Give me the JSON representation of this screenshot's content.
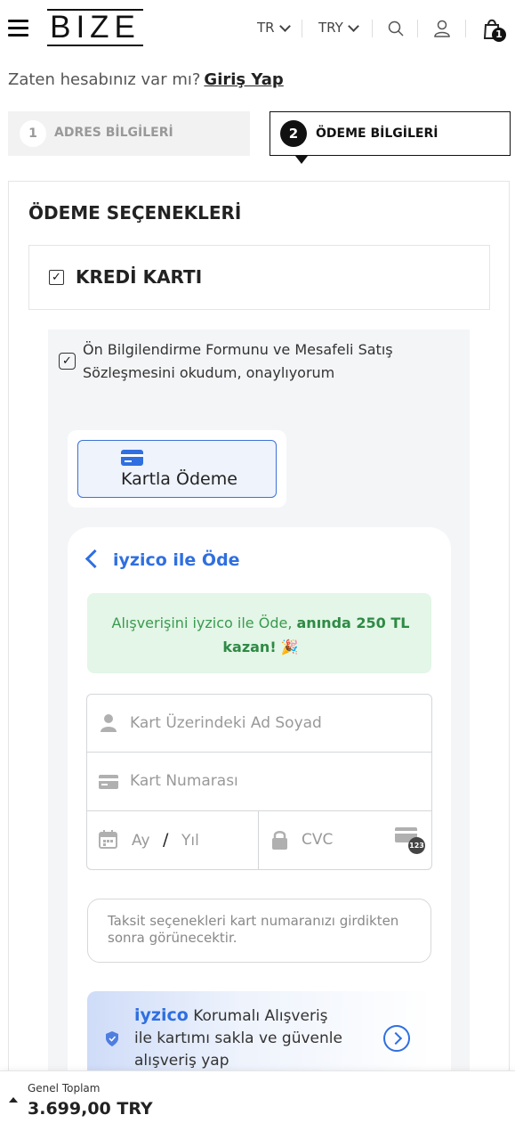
{
  "header": {
    "logo": "BIZE",
    "language": "TR",
    "currency": "TRY",
    "cart_count": "1",
    "icons": [
      "menu-icon",
      "search-icon",
      "user-icon",
      "cart-icon"
    ]
  },
  "login_prompt": {
    "text": "Zaten hesabınız var mı?",
    "link": "Giriş Yap"
  },
  "steps": [
    {
      "number": "1",
      "label": "ADRES BİLGİLERİ"
    },
    {
      "number": "2",
      "label": "ÖDEME BİLGİLERİ"
    }
  ],
  "payment": {
    "title": "ÖDEME SEÇENEKLERİ",
    "method_label": "KREDİ KARTI",
    "method_checked": "✓",
    "agreement_text": "Ön Bilgilendirme Formunu ve Mesafeli Satış Sözleşmesini okudum, onaylıyorum",
    "agreement_checked": "✓",
    "card_tab_label": "Kartla Ödeme"
  },
  "iyzico": {
    "header": "iyzico ile Öde",
    "promo_text": "Alışverişini iyzico ile Öde,",
    "promo_bold": "anında 250 TL kazan!",
    "promo_emoji": "🎉",
    "name_placeholder": "Kart Üzerindeki Ad Soyad",
    "number_placeholder": "Kart Numarası",
    "month_placeholder": "Ay",
    "slash": "/",
    "year_placeholder": "Yıl",
    "cvc_placeholder": "CVC",
    "cvc_badge": "123",
    "installment_note": "Taksit seçenekleri kart numaranızı girdikten sonra görünecektir.",
    "protect_brand": "iyzico",
    "protect_text_1": "Korumalı Alışveriş",
    "protect_text_2": "ile kartımı sakla ve güvenle alışveriş yap"
  },
  "footer": {
    "label": "Genel Toplam",
    "total": "3.699,00 TRY"
  },
  "colors": {
    "accent": "#2f6fe0",
    "promo_bg": "#e3f6e7",
    "promo_text": "#3a9a4f"
  }
}
